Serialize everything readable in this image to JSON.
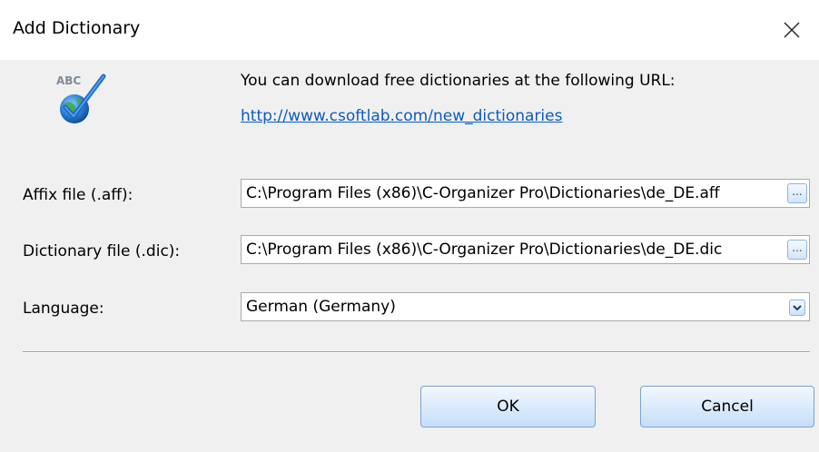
{
  "window": {
    "title": "Add Dictionary",
    "close_icon": "close-icon"
  },
  "info": {
    "text": "You can download free dictionaries at the following URL:",
    "link": "http://www.csoftlab.com/new_dictionaries",
    "icon": "spellcheck-abc-icon",
    "icon_text": "ABC"
  },
  "form": {
    "affix": {
      "label": "Affix file (.aff):",
      "value": "C:\\Program Files (x86)\\C-Organizer Pro\\Dictionaries\\de_DE.aff",
      "browse_label": "..."
    },
    "dictionary": {
      "label": "Dictionary file (.dic):",
      "value": "C:\\Program Files (x86)\\C-Organizer Pro\\Dictionaries\\de_DE.dic",
      "browse_label": "..."
    },
    "language": {
      "label": "Language:",
      "value": "German (Germany)"
    }
  },
  "buttons": {
    "ok": "OK",
    "cancel": "Cancel"
  },
  "colors": {
    "link": "#0b5cbf",
    "button_border": "#7da2ce",
    "dialog_bg": "#f0f0f0"
  }
}
